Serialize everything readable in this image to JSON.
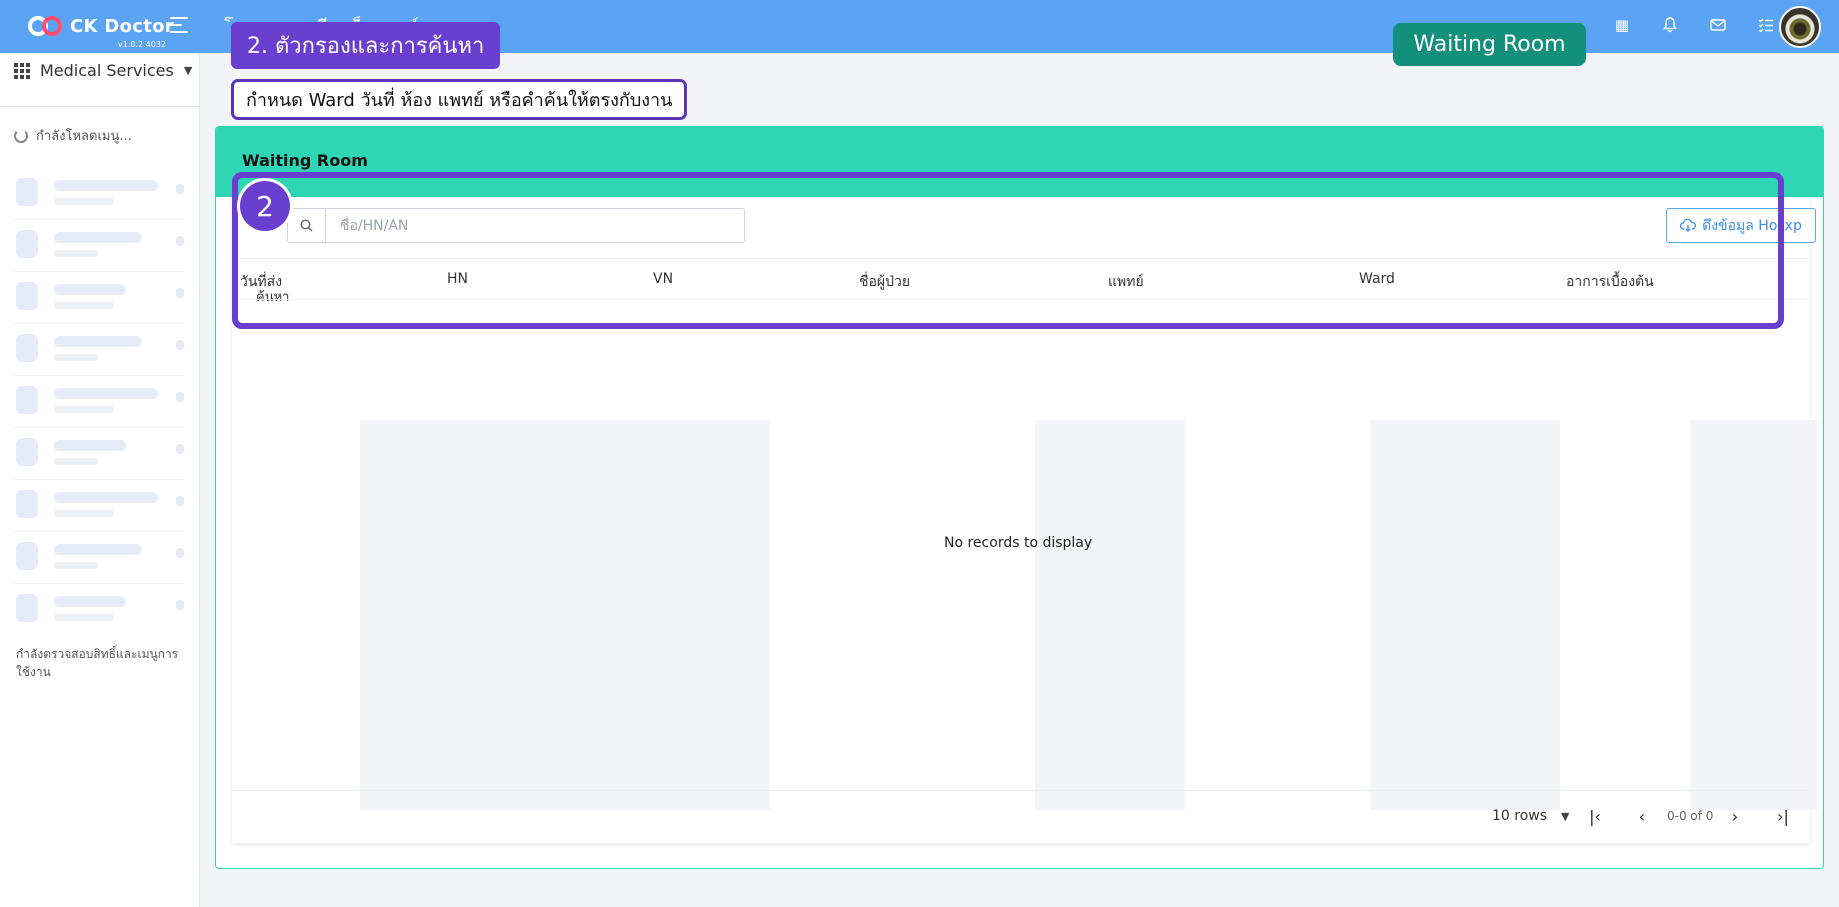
{
  "app": {
    "brand": "CK Doctor",
    "version": "v1.0.2.4032",
    "hospital_title": "โรงพยาบาลจีนแอ็ดวานซ์"
  },
  "sidebar": {
    "section_label": "Medical Services",
    "loading_text": "กำลังโหลดเมนู...",
    "checking_text": "กำลังตรวจสอบสิทธิ์และเมนูการใช้งาน"
  },
  "card": {
    "title": "Waiting Room"
  },
  "filters": {
    "search_label": "ค้นหา",
    "search_placeholder": "ชื่อ/HN/AN",
    "hosxp_button": "ดึงข้อมูล Hosxp"
  },
  "table": {
    "columns": [
      "วันที่ส่ง",
      "HN",
      "VN",
      "ชื่อผู้ป่วย",
      "แพทย์",
      "Ward",
      "อาการเบื้องต้น"
    ],
    "empty_text": "No records to display"
  },
  "pagination": {
    "rows_label": "10 rows",
    "info": "0-0 of 0"
  },
  "annotations": {
    "step_tag": "2. ตัวกรองและการค้นหา",
    "step_desc": "กำหนด Ward วันที่ ห้อง แพทย์ หรือคำค้นให้ตรงกับงาน",
    "page_tag": "Waiting Room",
    "step_number": "2"
  },
  "colors": {
    "topbar": "#5ba4f4",
    "card_header": "#2fd6b5",
    "annotation_purple": "#6a3fcf",
    "annotation_green": "#12907c"
  }
}
